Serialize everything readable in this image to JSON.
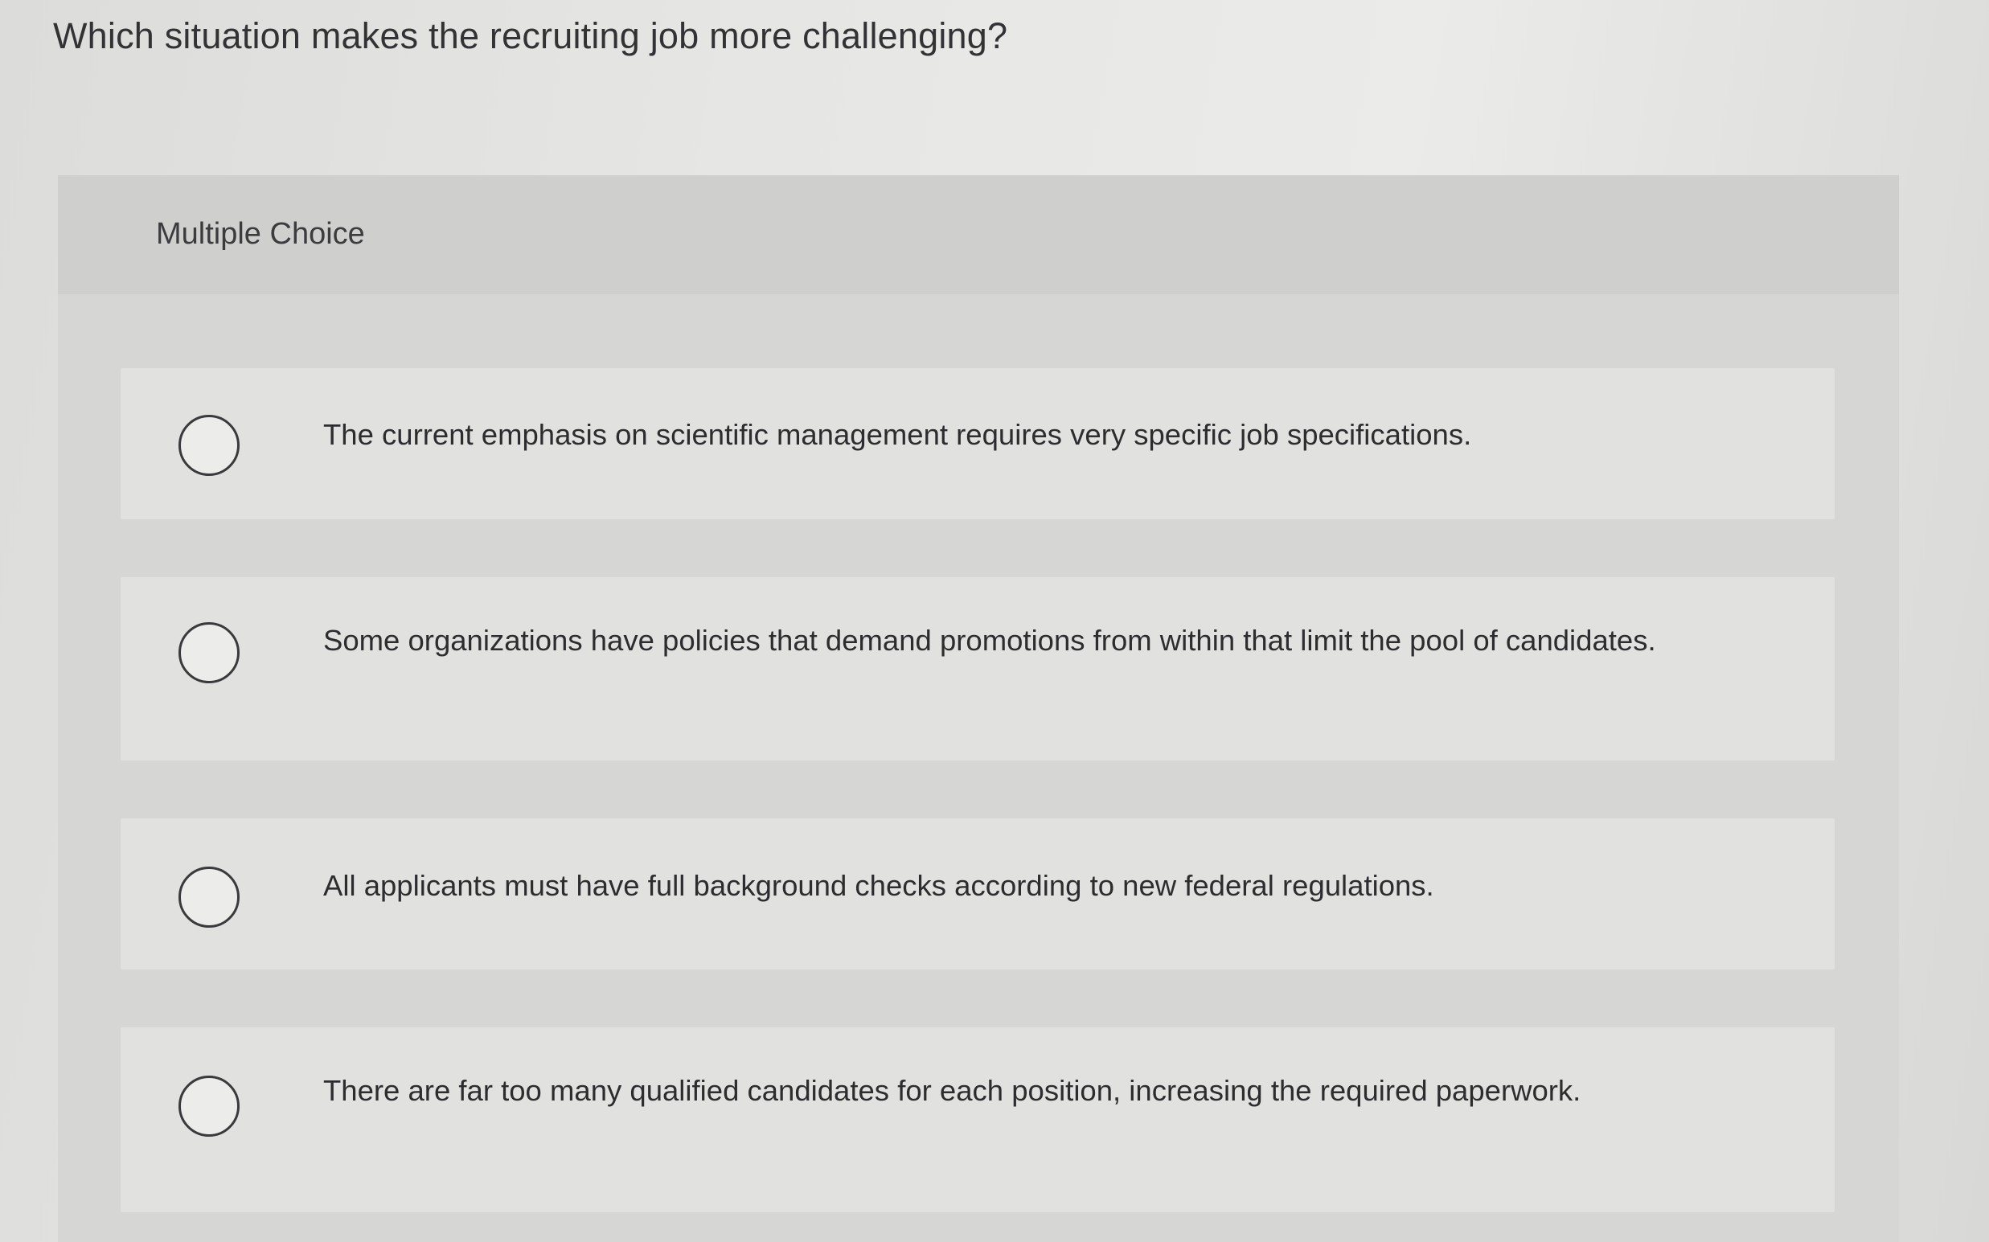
{
  "question": {
    "text": "Which situation makes the recruiting job more challenging?"
  },
  "card": {
    "header_label": "Multiple Choice"
  },
  "choices": [
    {
      "text": "The current emphasis on scientific management requires very specific job specifications.",
      "selected": false
    },
    {
      "text": "Some organizations have policies that demand promotions from within that limit the pool of candidates.",
      "selected": false
    },
    {
      "text": "All applicants must have full background checks according to new federal regulations.",
      "selected": false
    },
    {
      "text": "There are far too many qualified candidates for each position, increasing the required paperwork.",
      "selected": false
    }
  ],
  "icons": {
    "radio": "radio-unchecked-icon"
  }
}
